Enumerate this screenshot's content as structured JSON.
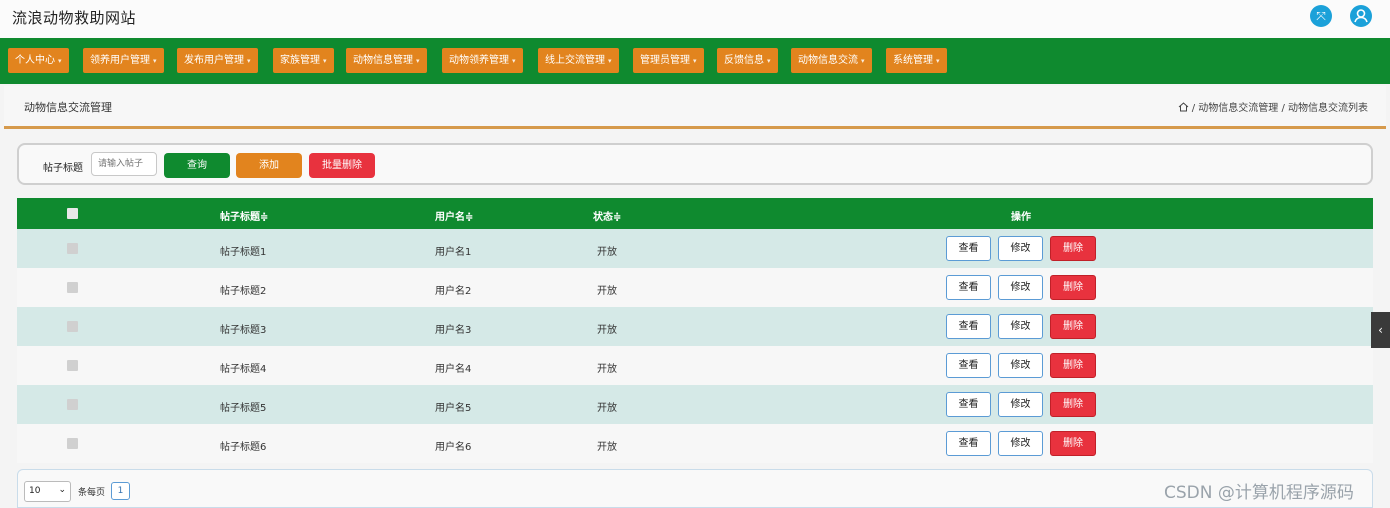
{
  "app": {
    "title": "流浪动物救助网站",
    "icons": {
      "fullscreen": "fullscreen-icon",
      "user": "user-icon"
    }
  },
  "nav": {
    "items": [
      {
        "label": "个人中心"
      },
      {
        "label": "领养用户管理"
      },
      {
        "label": "发布用户管理"
      },
      {
        "label": "家族管理"
      },
      {
        "label": "动物信息管理"
      },
      {
        "label": "动物领养管理"
      },
      {
        "label": "线上交流管理"
      },
      {
        "label": "管理员管理"
      },
      {
        "label": "反馈信息"
      },
      {
        "label": "动物信息交流"
      },
      {
        "label": "系统管理"
      }
    ],
    "caret": "▾"
  },
  "crumb": {
    "title": "动物信息交流管理",
    "home_icon": "home-icon",
    "path": "/ 动物信息交流管理 / 动物信息交流列表"
  },
  "search": {
    "label": "帖子标题",
    "placeholder": "请输入帖子",
    "query": "查询",
    "add": "添加",
    "batch_delete": "批量删除"
  },
  "table": {
    "headers": {
      "title": "帖子标题≑",
      "user": "用户名≑",
      "status": "状态≑",
      "actions": "操作"
    },
    "rows": [
      {
        "title": "帖子标题1",
        "user": "用户名1",
        "status": "开放"
      },
      {
        "title": "帖子标题2",
        "user": "用户名2",
        "status": "开放"
      },
      {
        "title": "帖子标题3",
        "user": "用户名3",
        "status": "开放"
      },
      {
        "title": "帖子标题4",
        "user": "用户名4",
        "status": "开放"
      },
      {
        "title": "帖子标题5",
        "user": "用户名5",
        "status": "开放"
      },
      {
        "title": "帖子标题6",
        "user": "用户名6",
        "status": "开放"
      }
    ],
    "actions": {
      "view": "查看",
      "edit": "修改",
      "delete": "删除"
    }
  },
  "pager": {
    "page_size": "10",
    "per_page_label": "条每页",
    "current_page": "1"
  },
  "watermark": "CSDN @计算机程序源码",
  "colors": {
    "nav_bg": "#0f8a2f",
    "nav_item": "#e2841e",
    "header_bg": "#0f8a2f",
    "query_btn": "#0f8a2f",
    "add_btn": "#e2841e",
    "delete_btn": "#e8323e",
    "row_alt": "#d5e9e7",
    "icon_blue": "#1ba1d9"
  }
}
